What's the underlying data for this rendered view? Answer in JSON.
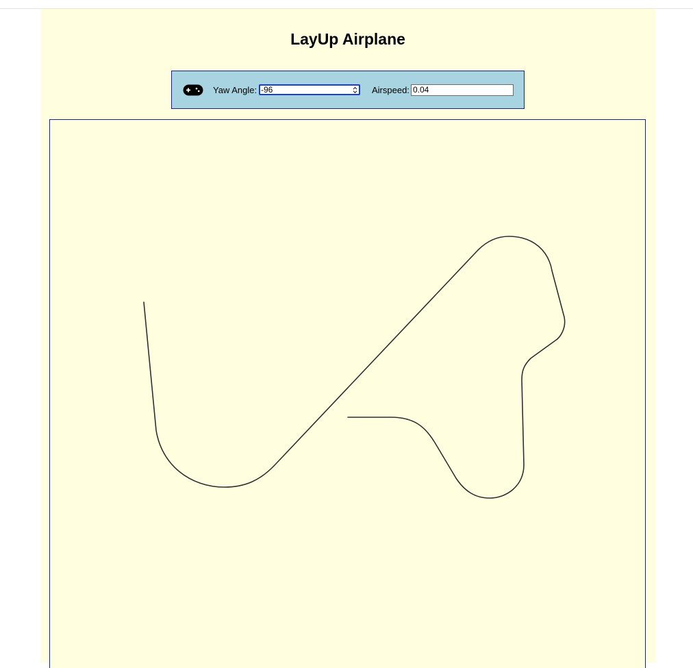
{
  "app": {
    "title": "LayUp Airplane"
  },
  "controls": {
    "gamepad_icon": "gamepad-icon",
    "yaw_label": "Yaw Angle:",
    "yaw_value": "-96",
    "airspeed_label": "Airspeed:",
    "airspeed_value": "0.04"
  },
  "colors": {
    "page_background": "#ffffe0",
    "panel_background": "#a8d3e0",
    "border": "#1a237e",
    "path_stroke": "#2f2f2f"
  }
}
